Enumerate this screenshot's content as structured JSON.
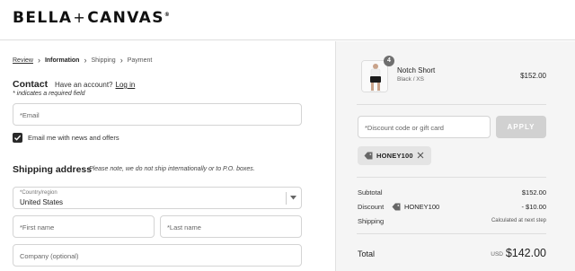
{
  "brand": {
    "name_left": "BELLA",
    "plus": "+",
    "name_right": "CANVAS",
    "reg": "®"
  },
  "breadcrumb": {
    "items": [
      {
        "label": "Review",
        "state": "link"
      },
      {
        "label": "Information",
        "state": "current"
      },
      {
        "label": "Shipping",
        "state": "upcoming"
      },
      {
        "label": "Payment",
        "state": "upcoming"
      }
    ],
    "separator": "›"
  },
  "contact": {
    "title": "Contact",
    "have_account": "Have an account?",
    "login_label": "Log in",
    "required_note": "* indicates a required field",
    "email_placeholder": "*Email",
    "newsletter_label": "Email me with news and offers",
    "newsletter_checked": true
  },
  "shipping": {
    "title": "Shipping address",
    "note": "Please note, we do not ship internationally or to P.O. boxes.",
    "country_label": "*Country/region",
    "country_value": "United States",
    "first_name_placeholder": "*First name",
    "last_name_placeholder": "*Last name",
    "company_placeholder": "Company (optional)"
  },
  "summary": {
    "item": {
      "name": "Notch Short",
      "variant": "Black / XS",
      "price": "$152.00",
      "quantity": "4"
    },
    "discount_placeholder": "*Discount code or gift card",
    "apply_label": "APPLY",
    "applied_code": "HONEY100",
    "subtotal_label": "Subtotal",
    "subtotal_value": "$152.00",
    "discount_label": "Discount",
    "discount_code": "HONEY100",
    "discount_value": "- $10.00",
    "shipping_label": "Shipping",
    "shipping_value": "Calculated at next step",
    "total_label": "Total",
    "total_currency": "USD",
    "total_value": "$142.00"
  },
  "colors": {
    "accent": "#2a2a2a",
    "apply_disabled": "#d1d1d1",
    "summary_bg": "#f5f5f5"
  }
}
